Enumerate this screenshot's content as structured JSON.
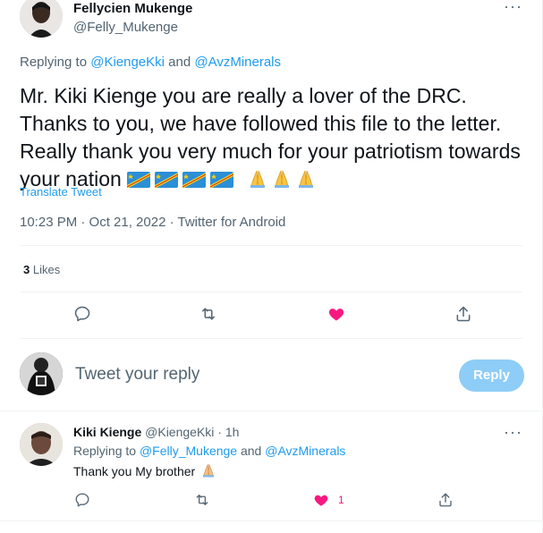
{
  "main_tweet": {
    "author": {
      "display_name": "Fellycien Mukenge",
      "handle": "@Felly_Mukenge"
    },
    "replying_prefix": "Replying to",
    "replying_to_1": "@KiengeKki",
    "replying_and": "and",
    "replying_to_2": "@AvzMinerals",
    "text_line_1": "Mr. Kiki Kienge you are really a lover of the DRC.",
    "text_line_2": "Thanks to you, we have followed this file to the letter.",
    "text_line_3": "Really thank you very much for your patriotism towards",
    "text_line_4": "your nation",
    "flag_count": 4,
    "pray_count": 3,
    "translate_label": "Translate Tweet",
    "timestamp": "10:23 PM · Oct 21, 2022 · Twitter for Android",
    "likes_count": "3",
    "likes_label": "Likes",
    "liked": true
  },
  "composer": {
    "placeholder": "Tweet your reply",
    "reply_button": "Reply"
  },
  "reply_tweet": {
    "display_name": "Kiki Kienge",
    "handle_time": "@KiengeKki · 1h",
    "replying_prefix": "Replying to",
    "replying_to_1": "@Felly_Mukenge",
    "replying_and": "and",
    "replying_to_2": "@AvzMinerals",
    "text": "Thank you My brother",
    "like_count": "1"
  },
  "icons": {
    "more": "more-horizontal-icon",
    "reply": "reply-icon",
    "retweet": "retweet-icon",
    "like": "heart-icon",
    "share": "share-icon"
  },
  "colors": {
    "accent": "#1d9bf0",
    "like": "#f91880",
    "muted": "#536471",
    "reply_button_disabled": "#8ecdf7"
  }
}
